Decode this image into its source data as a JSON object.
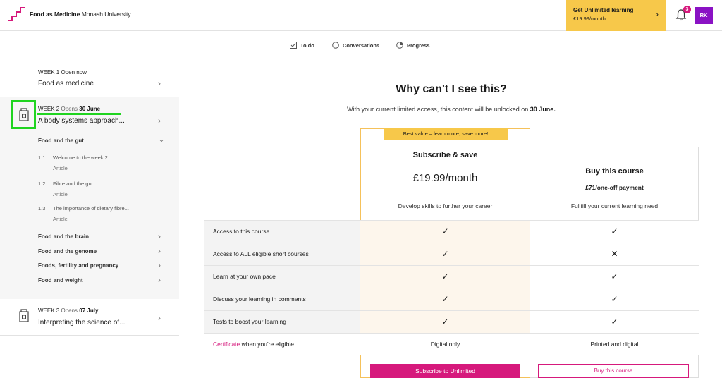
{
  "header": {
    "course_name": "Food as Medicine",
    "university": "Monash University",
    "unlimited_title": "Get Unlimited learning",
    "unlimited_price": "£19.99/month",
    "notification_count": "3",
    "avatar_initials": "RK",
    "logo_icon": "stairs-logo-icon",
    "colors": {
      "brand": "#d6197c",
      "promo": "#f7c84a",
      "avatar": "#8a12c4"
    }
  },
  "tabs": [
    {
      "label": "To do",
      "icon": "checkbox-icon"
    },
    {
      "label": "Conversations",
      "icon": "circle-icon"
    },
    {
      "label": "Progress",
      "icon": "progress-icon"
    }
  ],
  "sidebar": {
    "week1": {
      "label": "WEEK 1 Open now",
      "title": "Food as medicine"
    },
    "week2": {
      "week": "WEEK 2",
      "opens": "Opens",
      "date": "30 June",
      "title": "A body systems approach..."
    },
    "section_expanded": "Food and the gut",
    "steps": [
      {
        "num": "1.1",
        "title": "Welcome to the week 2",
        "kind": "Article"
      },
      {
        "num": "1.2",
        "title": "Fibre and the gut",
        "kind": "Article"
      },
      {
        "num": "1.3",
        "title": "The importance of dietary fibre...",
        "kind": "Article"
      }
    ],
    "sections": [
      "Food and the brain",
      "Food and the genome",
      "Foods, fertility and pregnancy",
      "Food and weight"
    ],
    "week3": {
      "week": "WEEK 3",
      "opens": "Opens",
      "date": "07 July",
      "title": "Interpreting the science of..."
    }
  },
  "main": {
    "heading": "Why can't I see this?",
    "subtitle_pre": "With your current limited access, this content will be unlocked on ",
    "subtitle_date": "30 June.",
    "ribbon": "Best value – learn more, save more!",
    "plan_subscribe": {
      "title": "Subscribe & save",
      "price": "£19.99/month",
      "desc": "Develop skills to further your career",
      "button": "Subscribe to Unlimited"
    },
    "plan_buy": {
      "title": "Buy this course",
      "price": "£71/one-off payment",
      "desc": "Fullfill your current learning need",
      "button": "Buy this course"
    },
    "features": [
      {
        "name": "Access to this course",
        "sub": "✓",
        "buy": "✓"
      },
      {
        "name": "Access to ALL eligible short courses",
        "sub": "✓",
        "buy": "✕"
      },
      {
        "name": "Learn at your own pace",
        "sub": "✓",
        "buy": "✓"
      },
      {
        "name": "Discuss your learning in comments",
        "sub": "✓",
        "buy": "✓"
      },
      {
        "name": "Tests to boost your learning",
        "sub": "✓",
        "buy": "✓"
      }
    ],
    "certificate_row": {
      "link": "Certificate",
      "rest": " when you're eligible",
      "sub": "Digital only",
      "buy": "Printed and digital"
    }
  }
}
